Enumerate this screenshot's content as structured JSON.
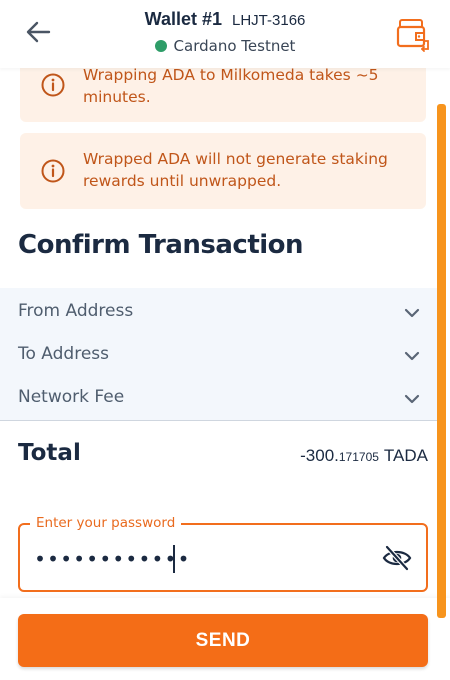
{
  "header": {
    "back_icon": "arrow-left-icon",
    "wallet_name": "Wallet #1",
    "wallet_id": "LHJT-3166",
    "network_status_color": "#2e9d68",
    "network_name": "Cardano Testnet",
    "switch_icon": "wallet-switch-icon"
  },
  "notices": [
    {
      "icon": "info-icon",
      "text": "Wrapping ADA to Milkomeda takes ~5 minutes."
    },
    {
      "icon": "info-icon",
      "text": "Wrapped ADA will not generate staking rewards until unwrapped."
    }
  ],
  "confirm": {
    "title": "Confirm Transaction",
    "rows": [
      {
        "label": "From Address",
        "icon": "chevron-down-icon"
      },
      {
        "label": "To Address",
        "icon": "chevron-down-icon"
      },
      {
        "label": "Network Fee",
        "icon": "chevron-down-icon"
      }
    ]
  },
  "total": {
    "label": "Total",
    "amount_main": "-300.",
    "amount_decimals": "171705",
    "unit": "TADA"
  },
  "password": {
    "label": "Enter your password",
    "value": "••••••••••••",
    "toggle_icon": "eye-off-icon"
  },
  "send_label": "SEND",
  "colors": {
    "accent": "#f46d17",
    "notice_bg": "#fef1e7",
    "notice_text": "#c0561a",
    "details_bg": "#f3f7fc",
    "text": "#1b2a41"
  }
}
